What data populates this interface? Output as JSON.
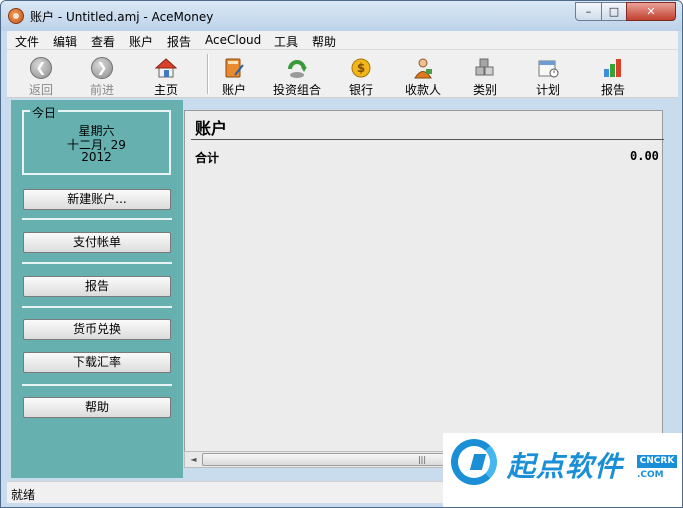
{
  "window": {
    "title": "账户 - Untitled.amj - AceMoney",
    "minimize_label": "–",
    "maximize_label": "□",
    "close_label": "✕"
  },
  "menu": [
    {
      "label": "文件"
    },
    {
      "label": "编辑"
    },
    {
      "label": "查看"
    },
    {
      "label": "账户"
    },
    {
      "label": "报告"
    },
    {
      "label": "AceCloud"
    },
    {
      "label": "工具"
    },
    {
      "label": "帮助"
    }
  ],
  "toolbar": {
    "back": {
      "label": "返回",
      "icon": "back-arrow-icon",
      "enabled": false
    },
    "forward": {
      "label": "前进",
      "icon": "forward-arrow-icon",
      "enabled": false
    },
    "home": {
      "label": "主页",
      "icon": "home-icon"
    },
    "accounts": {
      "label": "账户",
      "icon": "accounts-book-icon"
    },
    "portfolio": {
      "label": "投资组合",
      "icon": "portfolio-icon"
    },
    "bank": {
      "label": "银行",
      "icon": "bank-coin-icon"
    },
    "payees": {
      "label": "收款人",
      "icon": "payee-person-icon"
    },
    "categories": {
      "label": "类别",
      "icon": "category-blocks-icon"
    },
    "schedule": {
      "label": "计划",
      "icon": "calendar-icon"
    },
    "reports": {
      "label": "报告",
      "icon": "report-chart-icon"
    }
  },
  "sidebar": {
    "today": {
      "label": "今日",
      "weekday": "星期六",
      "date": "十二月, 29",
      "year": "2012"
    },
    "buttons": {
      "new_account": "新建账户...",
      "pay_bills": "支付帐单",
      "reports": "报告",
      "currency_exchange": "货币兑换",
      "download_rates": "下载汇率",
      "help": "帮助"
    }
  },
  "main": {
    "title": "账户",
    "total_label": "合计",
    "total_value": "0.00"
  },
  "scrollbar": {
    "left_arrow": "◄",
    "right_arrow": "►",
    "thumb_grip": "|||"
  },
  "status": {
    "text": "就绪"
  },
  "watermark": {
    "text": "起点软件",
    "badge": "CNCRK",
    "domain": ".COM"
  },
  "colors": {
    "sidebar_bg": "#67b0b0",
    "frame": "#c9dcee",
    "watermark_blue": "#1a8fd6"
  }
}
